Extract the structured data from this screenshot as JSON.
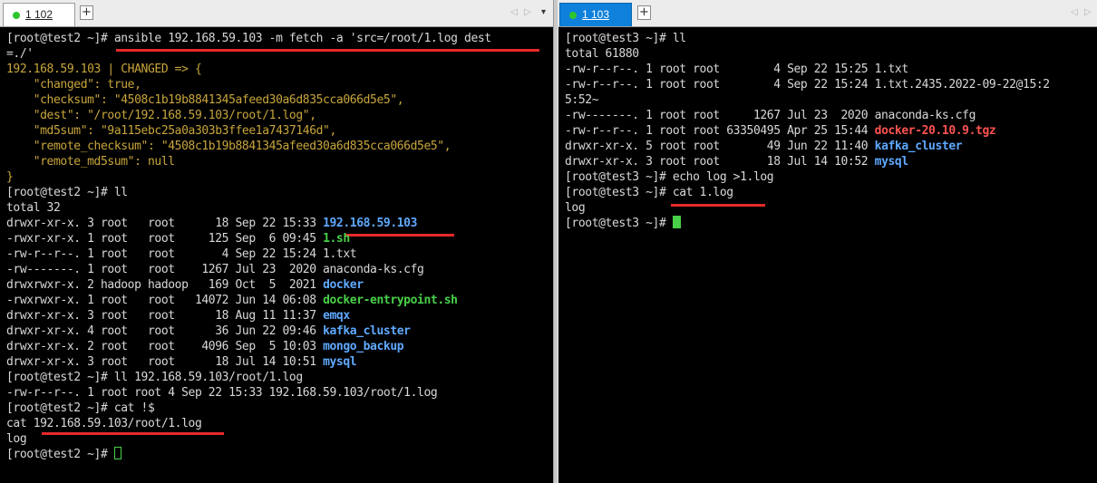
{
  "left_tab": {
    "label": "1 102"
  },
  "right_tab": {
    "label": "1 103"
  },
  "new_tab_symbol": "+",
  "nav": {
    "prev": "◁",
    "next": "▷",
    "dropdown": "▾"
  },
  "colors": {
    "yellow": "#c8a53c",
    "blue": "#5fa9ff",
    "green": "#48d048",
    "red": "#ff5252",
    "underline": "#e8292b",
    "tab_active": "#0f80dc"
  },
  "left_lines": [
    [
      {
        "t": "[root@test2 ~]# ansible 192.168.59.103 -m fetch -a 'src=/root/1.log dest",
        "c": "default"
      }
    ],
    [
      {
        "t": "=./'",
        "c": "default"
      }
    ],
    [
      {
        "t": "192.168.59.103 | CHANGED => {",
        "c": "yellow"
      }
    ],
    [
      {
        "t": "    \"changed\": true,",
        "c": "yellow"
      }
    ],
    [
      {
        "t": "    \"checksum\": \"4508c1b19b8841345afeed30a6d835cca066d5e5\",",
        "c": "yellow"
      }
    ],
    [
      {
        "t": "    \"dest\": \"/root/192.168.59.103/root/1.log\",",
        "c": "yellow"
      }
    ],
    [
      {
        "t": "    \"md5sum\": \"9a115ebc25a0a303b3ffee1a7437146d\",",
        "c": "yellow"
      }
    ],
    [
      {
        "t": "    \"remote_checksum\": \"4508c1b19b8841345afeed30a6d835cca066d5e5\",",
        "c": "yellow"
      }
    ],
    [
      {
        "t": "    \"remote_md5sum\": null",
        "c": "yellow"
      }
    ],
    [
      {
        "t": "}",
        "c": "yellow"
      }
    ],
    [
      {
        "t": "[root@test2 ~]# ll",
        "c": "default"
      }
    ],
    [
      {
        "t": "total 32",
        "c": "default"
      }
    ],
    [
      {
        "t": "drwxr-xr-x. 3 root   root      18 Sep 22 15:33 ",
        "c": "default"
      },
      {
        "t": "192.168.59.103",
        "c": "blue"
      }
    ],
    [
      {
        "t": "-rwxr-xr-x. 1 root   root     125 Sep  6 09:45 ",
        "c": "default"
      },
      {
        "t": "1.sh",
        "c": "green"
      }
    ],
    [
      {
        "t": "-rw-r--r--. 1 root   root       4 Sep 22 15:24 1.txt",
        "c": "default"
      }
    ],
    [
      {
        "t": "-rw-------. 1 root   root    1267 Jul 23  2020 anaconda-ks.cfg",
        "c": "default"
      }
    ],
    [
      {
        "t": "drwxrwxr-x. 2 hadoop hadoop   169 Oct  5  2021 ",
        "c": "default"
      },
      {
        "t": "docker",
        "c": "blue"
      }
    ],
    [
      {
        "t": "-rwxrwxr-x. 1 root   root   14072 Jun 14 06:08 ",
        "c": "default"
      },
      {
        "t": "docker-entrypoint.sh",
        "c": "green"
      }
    ],
    [
      {
        "t": "drwxr-xr-x. 3 root   root      18 Aug 11 11:37 ",
        "c": "default"
      },
      {
        "t": "emqx",
        "c": "blue"
      }
    ],
    [
      {
        "t": "drwxr-xr-x. 4 root   root      36 Jun 22 09:46 ",
        "c": "default"
      },
      {
        "t": "kafka_cluster",
        "c": "blue"
      }
    ],
    [
      {
        "t": "drwxr-xr-x. 2 root   root    4096 Sep  5 10:03 ",
        "c": "default"
      },
      {
        "t": "mongo_backup",
        "c": "blue"
      }
    ],
    [
      {
        "t": "drwxr-xr-x. 3 root   root      18 Jul 14 10:51 ",
        "c": "default"
      },
      {
        "t": "mysql",
        "c": "blue"
      }
    ],
    [
      {
        "t": "[root@test2 ~]# ll 192.168.59.103/root/1.log",
        "c": "default"
      }
    ],
    [
      {
        "t": "-rw-r--r--. 1 root root 4 Sep 22 15:33 192.168.59.103/root/1.log",
        "c": "default"
      }
    ],
    [
      {
        "t": "[root@test2 ~]# cat !$",
        "c": "default"
      }
    ],
    [
      {
        "t": "cat 192.168.59.103/root/1.log",
        "c": "default"
      }
    ],
    [
      {
        "t": "log",
        "c": "default"
      }
    ],
    [
      {
        "t": "[root@test2 ~]# ",
        "c": "default"
      }
    ]
  ],
  "right_lines": [
    [
      {
        "t": "[root@test3 ~]# ll",
        "c": "default"
      }
    ],
    [
      {
        "t": "total 61880",
        "c": "default"
      }
    ],
    [
      {
        "t": "-rw-r--r--. 1 root root        4 Sep 22 15:25 1.txt",
        "c": "default"
      }
    ],
    [
      {
        "t": "-rw-r--r--. 1 root root        4 Sep 22 15:24 1.txt.2435.2022-09-22@15:2",
        "c": "default"
      }
    ],
    [
      {
        "t": "5:52~",
        "c": "default"
      }
    ],
    [
      {
        "t": "-rw-------. 1 root root     1267 Jul 23  2020 anaconda-ks.cfg",
        "c": "default"
      }
    ],
    [
      {
        "t": "-rw-r--r--. 1 root root 63350495 Apr 25 15:44 ",
        "c": "default"
      },
      {
        "t": "docker-20.10.9.tgz",
        "c": "red"
      }
    ],
    [
      {
        "t": "drwxr-xr-x. 5 root root       49 Jun 22 11:40 ",
        "c": "default"
      },
      {
        "t": "kafka_cluster",
        "c": "blue"
      }
    ],
    [
      {
        "t": "drwxr-xr-x. 3 root root       18 Jul 14 10:52 ",
        "c": "default"
      },
      {
        "t": "mysql",
        "c": "blue"
      }
    ],
    [
      {
        "t": "[root@test3 ~]# echo log >1.log",
        "c": "default"
      }
    ],
    [
      {
        "t": "[root@test3 ~]# cat 1.log",
        "c": "default"
      }
    ],
    [
      {
        "t": "log",
        "c": "default"
      }
    ],
    [
      {
        "t": "[root@test3 ~]# ",
        "c": "default"
      }
    ]
  ]
}
